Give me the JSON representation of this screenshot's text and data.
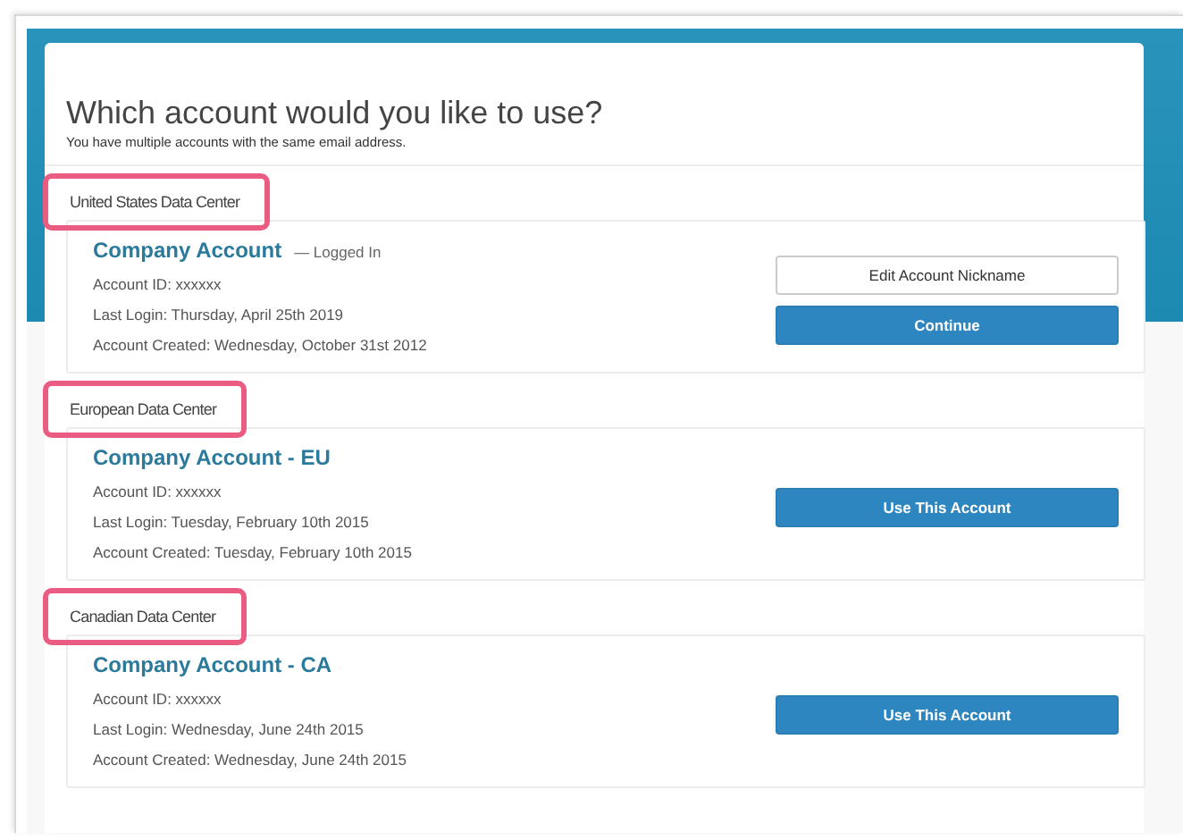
{
  "heading": {
    "title": "Which account would you like to use?",
    "subtitle": "You have multiple accounts with the same email address."
  },
  "sections": [
    {
      "label": "United States Data Center",
      "highlighted": true,
      "account": {
        "name": "Company Account",
        "status": "— Logged In",
        "details": [
          "Account ID: xxxxxx",
          "Last Login: Thursday, April 25th 2019",
          "Account Created: Wednesday, October 31st 2012"
        ],
        "buttons": [
          {
            "label": "Edit Account Nickname",
            "kind": "secondary"
          },
          {
            "label": "Continue",
            "kind": "primary"
          }
        ]
      }
    },
    {
      "label": "European Data Center",
      "highlighted": true,
      "account": {
        "name": "Company Account - EU",
        "details": [
          "Account ID: xxxxxx",
          "Last Login: Tuesday, February 10th 2015",
          "Account Created: Tuesday, February 10th 2015"
        ],
        "buttons": [
          {
            "label": "Use This Account",
            "kind": "primary"
          }
        ]
      }
    },
    {
      "label": "Canadian Data Center",
      "highlighted": true,
      "account": {
        "name": "Company Account - CA",
        "details": [
          "Account ID: xxxxxx",
          "Last Login: Wednesday, June 24th 2015",
          "Account Created: Wednesday, June 24th 2015"
        ],
        "buttons": [
          {
            "label": "Use This Account",
            "kind": "primary"
          }
        ]
      }
    }
  ]
}
